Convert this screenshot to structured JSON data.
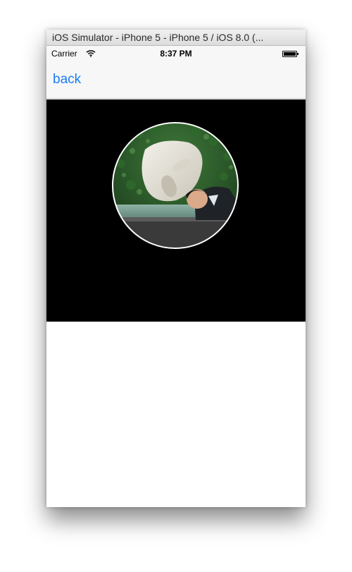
{
  "window": {
    "title": "iOS Simulator - iPhone 5 - iPhone 5 / iOS 8.0 (..."
  },
  "status_bar": {
    "carrier": "Carrier",
    "time": "8:37 PM",
    "wifi_icon": "wifi-icon",
    "battery_icon": "battery-icon",
    "battery_level": 1.0
  },
  "nav_bar": {
    "back_label": "back"
  },
  "image_panel": {
    "background_color": "#000000",
    "photo": "circular-profile-photo",
    "photo_border_color": "#ffffff"
  },
  "colors": {
    "tint": "#1a7cf5",
    "bar_background": "#f7f7f7"
  }
}
